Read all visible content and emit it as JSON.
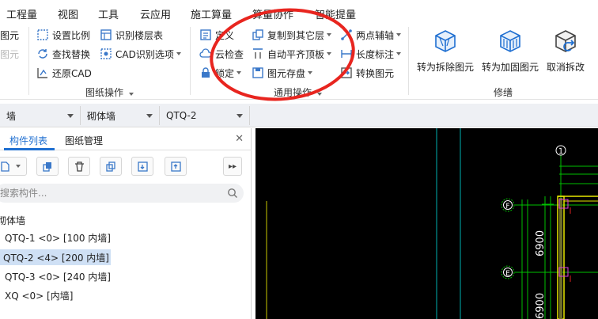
{
  "menu": [
    "工程量",
    "视图",
    "工具",
    "云应用",
    "施工算量",
    "算量协作",
    "智能提量"
  ],
  "ribbon": {
    "col0": [
      "图元",
      "图元"
    ],
    "col1": [
      "设置比例",
      "查找替换",
      "还原CAD"
    ],
    "col2": [
      "识别楼层表",
      "CAD识别选项"
    ],
    "drawing_group_label": "图纸操作",
    "col3": [
      "定义",
      "云检查",
      "锁定"
    ],
    "col4": [
      "复制到其它层",
      "自动平齐顶板",
      "图元存盘"
    ],
    "col5": [
      "两点辅轴",
      "长度标注",
      "转换图元"
    ],
    "general_group_label": "通用操作",
    "modify": [
      "转为拆除图元",
      "转为加固图元",
      "取消拆改"
    ],
    "modify_group_label": "修缮"
  },
  "combos": [
    "墙",
    "砌体墙",
    "QTQ-2"
  ],
  "panel": {
    "tab_components": "构件列表",
    "tab_drawings": "图纸管理",
    "close": "✕",
    "search_placeholder": "搜索构件...",
    "tree_root": "砌体墙",
    "items": [
      "QTQ-1 <0> [100 内墙]",
      "QTQ-2 <4> [200 内墙]",
      "QTQ-3 <0> [240 内墙]",
      "XQ <0> [内墙]"
    ]
  },
  "cad": {
    "axis_top": "1",
    "axis_f": "F",
    "axis_e": "E",
    "dim_1": "6900",
    "dim_2": "6900"
  },
  "colors": {
    "accent": "#1f6fd1",
    "annotation": "#e8251f",
    "cad_green": "#00c000",
    "cad_cyan": "#00c0c0",
    "cad_yellow": "#e8e800"
  }
}
